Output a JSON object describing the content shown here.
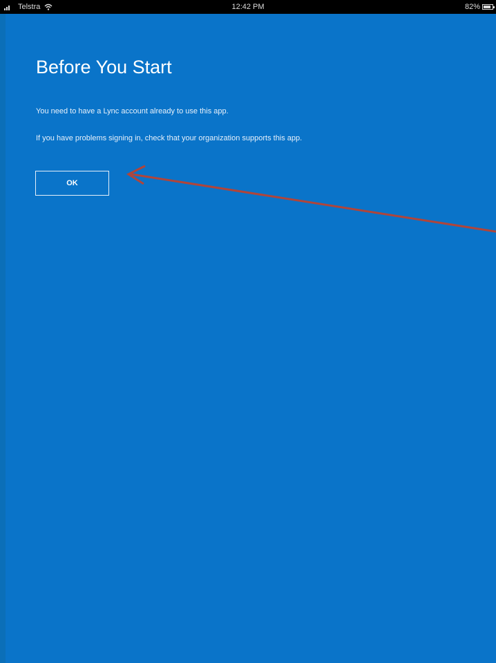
{
  "status_bar": {
    "carrier": "Telstra",
    "time": "12:42 PM",
    "battery": "82%"
  },
  "dialog": {
    "title": "Before You Start",
    "line1": "You need to have a Lync account already to use this app.",
    "line2": "If you have problems signing in, check that your organization supports this app.",
    "ok_label": "OK"
  },
  "icons": {
    "signal": "signal-bars-icon",
    "wifi": "wifi-icon",
    "battery": "battery-icon"
  },
  "colors": {
    "background": "#0a74c9",
    "status_bar": "#000000",
    "text": "#ffffff",
    "annotation_arrow": "#b0453a"
  }
}
